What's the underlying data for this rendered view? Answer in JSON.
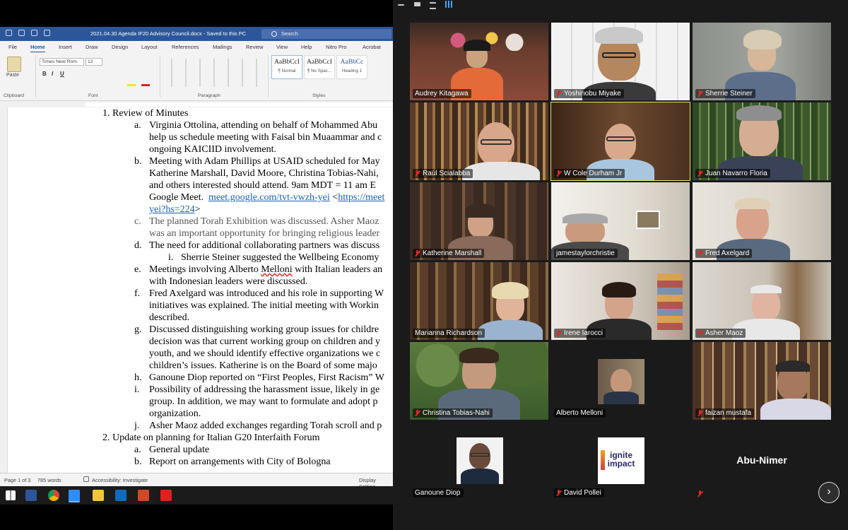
{
  "word": {
    "title": "2021.04.30 Agenda IF20 Advisory Council.docx  -  Saved to this PC",
    "search_placeholder": "Search",
    "menu": [
      "File",
      "Home",
      "Insert",
      "Draw",
      "Design",
      "Layout",
      "References",
      "Mailings",
      "Review",
      "View",
      "Help",
      "Nitro Pro",
      "Acrobat"
    ],
    "ribbon": {
      "paste_label": "Paste",
      "font_name": "Times New Rom",
      "font_size": "12",
      "format_buttons": [
        "B",
        "I",
        "U"
      ],
      "styles": [
        {
          "preview": "AaBbCcI",
          "name": "¶ Normal"
        },
        {
          "preview": "AaBbCcI",
          "name": "¶ No Spac..."
        },
        {
          "preview": "AaBbCc",
          "name": "Heading 1"
        }
      ],
      "groups": [
        "Clipboard",
        "Font",
        "Paragraph",
        "Styles"
      ]
    },
    "document_lines": [
      "1.   Review of Minutes",
      "a.",
      "Virginia Ottolina, attending on behalf of Mohammed Abu",
      "help us schedule meeting with Faisal bin Muaammar and c",
      "ongoing KAICIID involvement.",
      "b.",
      "Meeting with Adam Phillips at USAID scheduled for May",
      "Katherine Marshall, David Moore, Christina Tobias-Nahi,",
      "and others interested should attend.  9am MDT = 11 am E",
      "Google Meet.",
      "meet.google.com/tvt-vwzh-yei",
      "<",
      "https://meet",
      "yei?hs=224",
      ">",
      "c.",
      "The planned Torah Exhibition was discussed. Asher Maoz",
      "was an important opportunity for bringing religious leader",
      "d.",
      "The need for additional collaborating partners was discuss",
      "i.",
      "Sherrie Steiner suggested the Wellbeing Economy",
      "e.",
      "Meetings involving Alberto ",
      "Melloni",
      " with Italian leaders an",
      "with Indonesian leaders were discussed.",
      "f.",
      "Fred Axelgard was introduced and his role in supporting W",
      "initiatives was explained.  The initial meeting with Workin",
      "described.",
      "g.",
      "Discussed distinguishing working group issues for childre",
      "decision was that current working group on children and y",
      "youth, and we should identify effective organizations we c",
      "children’s issues.  Katherine is on the Board of some majo",
      "h.",
      "Ganoune Diop reported on “First Peoples, First Racism” W",
      "i.",
      "Possibility of addressing the harassment issue, likely in ge",
      "group.  In addition, we may want to formulate and adopt p",
      "organization.",
      "j.",
      "Asher Maoz added exchanges regarding Torah scroll and p",
      "2.   Update on planning for Italian G20 Interfaith Forum",
      "a.",
      "General update",
      "b.",
      "Report on arrangements with City of Bologna"
    ],
    "status": {
      "page": "Page 1 of 3",
      "words": "785 words",
      "accessibility": "Accessibility: Investigate",
      "display": "Display Setting"
    }
  },
  "zoom": {
    "participants": [
      {
        "name": "Audrey Kitagawa",
        "muted": false
      },
      {
        "name": "Yoshinobu Miyake",
        "muted": true
      },
      {
        "name": "Sherrie Steiner",
        "muted": true
      },
      {
        "name": "Raúl Scialabba",
        "muted": true
      },
      {
        "name": "W Cole Durham Jr",
        "muted": true
      },
      {
        "name": "Juan Navarro Floria",
        "muted": true
      },
      {
        "name": "Katherine Marshall",
        "muted": true
      },
      {
        "name": "jamestaylorchristie",
        "muted": false
      },
      {
        "name": "Fred Axelgard",
        "muted": true
      },
      {
        "name": "Marianna Richardson",
        "muted": false
      },
      {
        "name": "Irene Iarocci",
        "muted": true
      },
      {
        "name": "Asher Maoz",
        "muted": true
      },
      {
        "name": "Christina Tobias-Nahi",
        "muted": true
      },
      {
        "name": "Alberto Melloni",
        "muted": false
      },
      {
        "name": "faizan mustafa",
        "muted": true
      },
      {
        "name": "Ganoune Diop",
        "muted": false
      },
      {
        "name": "David Pollei",
        "muted": true
      },
      {
        "name": "Abu-Nimer",
        "muted": true
      }
    ],
    "pollei_logo_line1": "ignite",
    "pollei_logo_line2": "impact",
    "next_page_icon": "chevron-right-icon"
  },
  "colors": {
    "word_blue": "#2b579a",
    "zoom_bg": "#1a1a1a",
    "muted_red": "#e02828",
    "active_speaker": "#e6e65c"
  }
}
